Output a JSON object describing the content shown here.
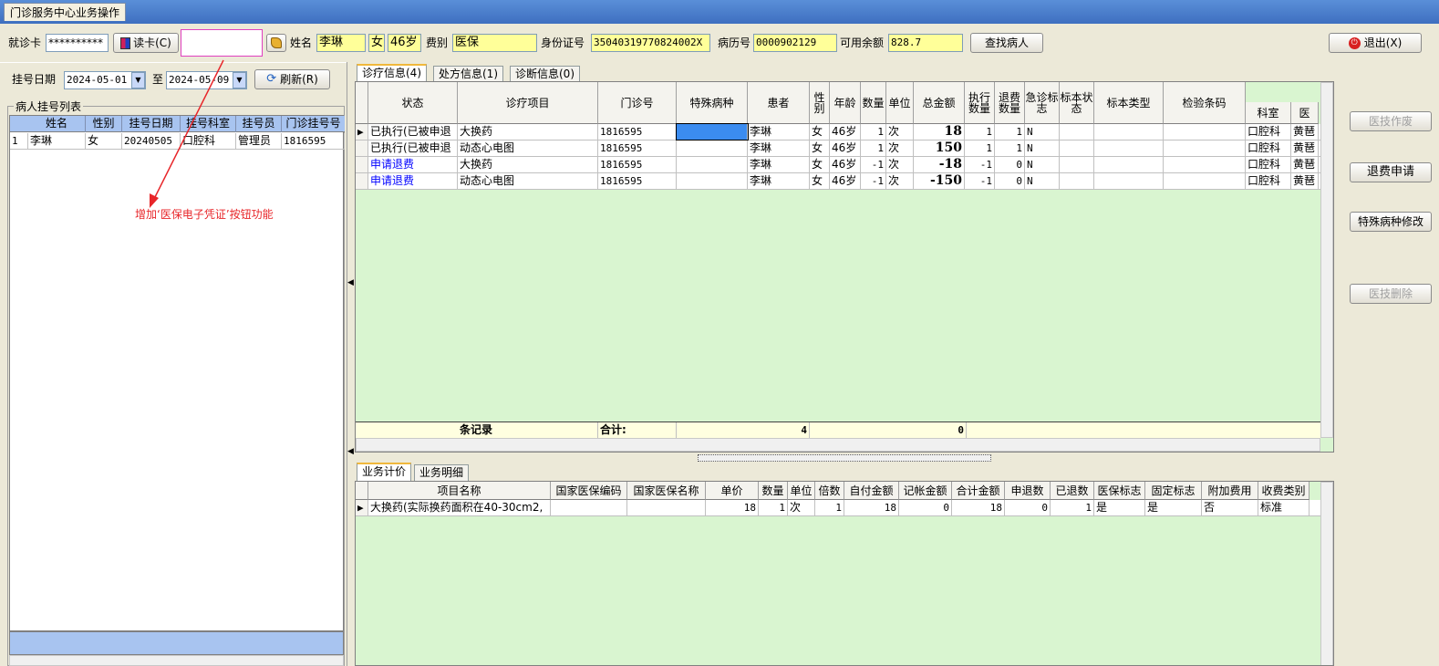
{
  "window": {
    "title": "门诊服务中心业务操作"
  },
  "top": {
    "card_label": "就诊卡",
    "card_value": "**********",
    "read_card_button": "读卡(C)",
    "name_label": "姓名",
    "name_value": "李琳",
    "sex_value": "女",
    "age_value": "46岁",
    "fee_label": "费别",
    "fee_value": "医保",
    "id_label": "身份证号",
    "id_value": "35040319770824002X",
    "record_label": "病历号",
    "record_value": "0000902129",
    "balance_label": "可用余额",
    "balance_value": "828.7",
    "find_button": "查找病人",
    "exit_button": "退出(X)"
  },
  "left": {
    "date_label": "挂号日期",
    "date_from": "2024-05-01",
    "date_to_label": "至",
    "date_to": "2024-05-09",
    "refresh_button": "刷新(R)",
    "group_title": "病人挂号列表",
    "columns": [
      "姓名",
      "性别",
      "挂号日期",
      "挂号科室",
      "挂号员",
      "门诊挂号号"
    ],
    "rows": [
      [
        "1",
        "李琳",
        "女",
        "20240505",
        "口腔科",
        "管理员",
        "1816595"
      ]
    ]
  },
  "annotation": {
    "text": "增加‘医保电子凭证’按钮功能",
    "color": "#e8262a"
  },
  "upper_tabs": [
    "诊疗信息(4)",
    "处方信息(1)",
    "诊断信息(0)"
  ],
  "upper_grid": {
    "columns": [
      "状态",
      "诊疗项目",
      "门诊号",
      "特殊病种",
      "患者",
      "性别",
      "年龄",
      "数量",
      "单位",
      "总金额",
      "执行数量",
      "退费数量",
      "急诊标志",
      "标本状态",
      "标本类型",
      "检验条码",
      "科室",
      "医"
    ],
    "rows": [
      {
        "status": "已执行(已被申退",
        "item": "大换药",
        "clinic": "1816595",
        "special": "",
        "patient": "李琳",
        "sex": "女",
        "age": "46岁",
        "qty": "1",
        "unit": "次",
        "total": "18",
        "exec": "1",
        "refund": "1",
        "urgent": "N",
        "dept": "口腔科",
        "doctor": "黄琶"
      },
      {
        "status": "已执行(已被申退",
        "item": "动态心电图",
        "clinic": "1816595",
        "special": "",
        "patient": "李琳",
        "sex": "女",
        "age": "46岁",
        "qty": "1",
        "unit": "次",
        "total": "150",
        "exec": "1",
        "refund": "1",
        "urgent": "N",
        "dept": "口腔科",
        "doctor": "黄琶"
      },
      {
        "status": "申请退费",
        "item": "大换药",
        "clinic": "1816595",
        "special": "",
        "patient": "李琳",
        "sex": "女",
        "age": "46岁",
        "qty": "-1",
        "unit": "次",
        "total": "-18",
        "exec": "-1",
        "refund": "0",
        "urgent": "N",
        "dept": "口腔科",
        "doctor": "黄琶"
      },
      {
        "status": "申请退费",
        "item": "动态心电图",
        "clinic": "1816595",
        "special": "",
        "patient": "李琳",
        "sex": "女",
        "age": "46岁",
        "qty": "-1",
        "unit": "次",
        "total": "-150",
        "exec": "-1",
        "refund": "0",
        "urgent": "N",
        "dept": "口腔科",
        "doctor": "黄琶"
      }
    ],
    "footer": {
      "records_label": "条记录",
      "sum_label": "合计:",
      "count": "4",
      "total": "0"
    }
  },
  "right_buttons": [
    "医技作废",
    "退费申请",
    "特殊病种修改",
    "医技删除"
  ],
  "lower_tabs": [
    "业务计价",
    "业务明细"
  ],
  "lower_grid": {
    "columns": [
      "项目名称",
      "国家医保编码",
      "国家医保名称",
      "单价",
      "数量",
      "单位",
      "倍数",
      "自付金额",
      "记帐金额",
      "合计金额",
      "申退数",
      "已退数",
      "医保标志",
      "固定标志",
      "附加费用",
      "收费类别"
    ],
    "rows": [
      [
        "大换药(实际换药面积在40-30cm2,",
        "",
        "",
        "18",
        "1",
        "次",
        "1",
        "18",
        "0",
        "18",
        "0",
        "1",
        "是",
        "是",
        "否",
        "标准"
      ]
    ]
  },
  "colors": {
    "status_link": "#0000ff",
    "grid_bg": "#d9f5d0",
    "input_bg": "#ffff99",
    "title_bar": "#3e6fc0"
  },
  "icons": [
    "card-reader-icon",
    "broom-icon",
    "refresh-icon",
    "power-icon",
    "dropdown-arrow-icon",
    "row-pointer-icon"
  ]
}
